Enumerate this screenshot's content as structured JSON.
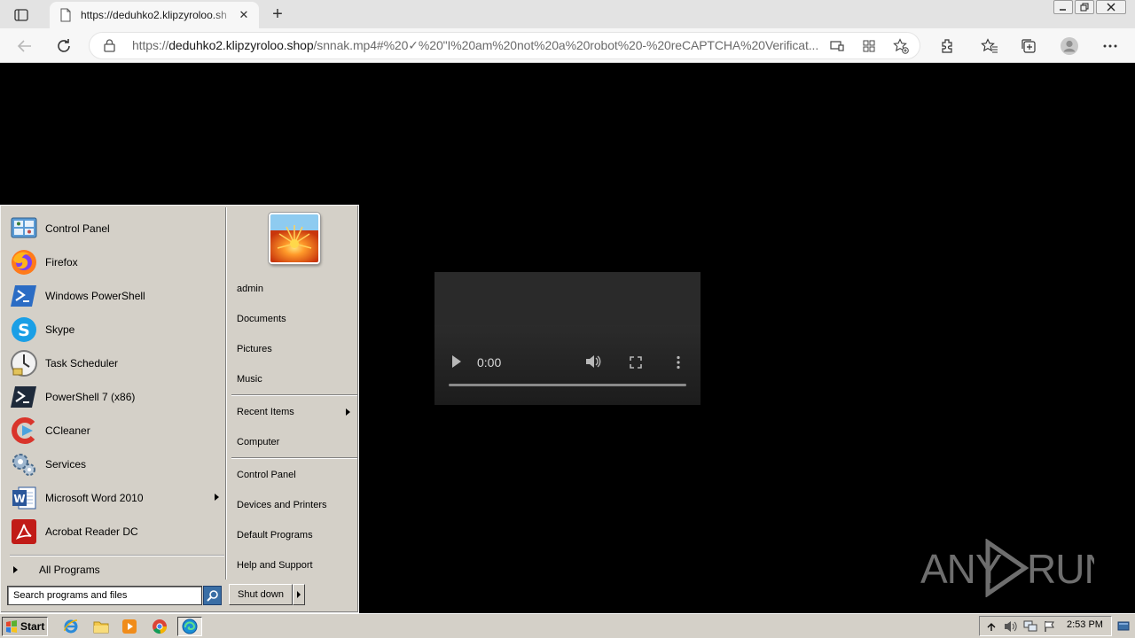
{
  "browser": {
    "tab": {
      "title": "https://deduhko2.klipzyroloo.sh"
    },
    "address": {
      "scheme": "https://",
      "host": "deduhko2.klipzyroloo.shop",
      "path": "/snnak.mp4#%20✓%20\"I%20am%20not%20a%20robot%20-%20reCAPTCHA%20Verificat..."
    }
  },
  "video": {
    "time": "0:00"
  },
  "watermark": {
    "text": "ANY RUN"
  },
  "start_menu": {
    "programs": [
      {
        "label": "Control Panel",
        "icon": "control-panel-icon",
        "has_submenu": false
      },
      {
        "label": "Firefox",
        "icon": "firefox-icon",
        "has_submenu": false
      },
      {
        "label": "Windows PowerShell",
        "icon": "powershell-icon",
        "has_submenu": false
      },
      {
        "label": "Skype",
        "icon": "skype-icon",
        "has_submenu": false
      },
      {
        "label": "Task Scheduler",
        "icon": "task-scheduler-icon",
        "has_submenu": false
      },
      {
        "label": "PowerShell 7 (x86)",
        "icon": "powershell7-icon",
        "has_submenu": false
      },
      {
        "label": "CCleaner",
        "icon": "ccleaner-icon",
        "has_submenu": false
      },
      {
        "label": "Services",
        "icon": "services-icon",
        "has_submenu": false
      },
      {
        "label": "Microsoft Word 2010",
        "icon": "word-icon",
        "has_submenu": true
      },
      {
        "label": "Acrobat Reader DC",
        "icon": "acrobat-icon",
        "has_submenu": false
      }
    ],
    "all_programs": "All Programs",
    "right_links": [
      {
        "label": "admin"
      },
      {
        "label": "Documents"
      },
      {
        "label": "Pictures"
      },
      {
        "label": "Music"
      },
      {
        "label": "Recent Items"
      },
      {
        "label": "Computer"
      },
      {
        "label": "Control Panel"
      },
      {
        "label": "Devices and Printers"
      },
      {
        "label": "Default Programs"
      },
      {
        "label": "Help and Support"
      }
    ],
    "search_placeholder": "Search programs and files",
    "shutdown": "Shut down"
  },
  "taskbar": {
    "start": "Start",
    "apps": [
      "internet-explorer-icon",
      "file-explorer-icon",
      "media-player-icon",
      "chrome-icon",
      "edge-icon"
    ],
    "clock": "2:53 PM"
  }
}
